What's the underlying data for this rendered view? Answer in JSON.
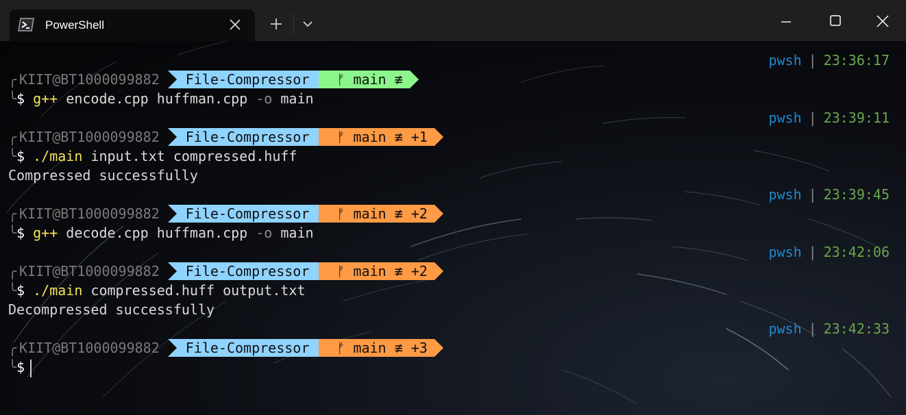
{
  "window": {
    "tab_title": "PowerShell",
    "tab_icon": "powershell-icon",
    "new_tab_icon": "plus-icon",
    "dropdown_icon": "chevron-down-icon",
    "minimize_icon": "minimize-icon",
    "maximize_icon": "maximize-icon",
    "close_icon": "close-icon"
  },
  "prompt": {
    "user": "KIIT@BT1000099882",
    "dir": "File-Compressor",
    "branch_glyph": "ᚠ",
    "branch": "main",
    "sync_glyph": "≢",
    "dollar": "$",
    "shell": "pwsh",
    "separator": "|",
    "colors": {
      "dir": "#8fd3ff",
      "git_clean": "#8cf58c",
      "git_dirty": "#ff9a45",
      "shell": "#1f8ad2",
      "time": "#6aa84f",
      "command": "#f5e356"
    }
  },
  "entries": [
    {
      "time": "23:36:17",
      "git_extra": "",
      "command": {
        "name": "g++",
        "args": " encode.cpp huffman.cpp ",
        "flag": "-o",
        "rest": " main"
      },
      "output": ""
    },
    {
      "time": "23:39:11",
      "git_extra": " +1",
      "command": {
        "name": "./main",
        "args": " input.txt compressed.huff",
        "flag": "",
        "rest": ""
      },
      "output": "Compressed successfully"
    },
    {
      "time": "23:39:45",
      "git_extra": " +2",
      "command": {
        "name": "g++",
        "args": " decode.cpp huffman.cpp ",
        "flag": "-o",
        "rest": " main"
      },
      "output": ""
    },
    {
      "time": "23:42:06",
      "git_extra": " +2",
      "command": {
        "name": "./main",
        "args": " compressed.huff output.txt",
        "flag": "",
        "rest": ""
      },
      "output": "Decompressed successfully"
    },
    {
      "time": "23:42:33",
      "git_extra": " +3",
      "command": {
        "name": "",
        "args": "",
        "flag": "",
        "rest": ""
      },
      "output": ""
    }
  ]
}
